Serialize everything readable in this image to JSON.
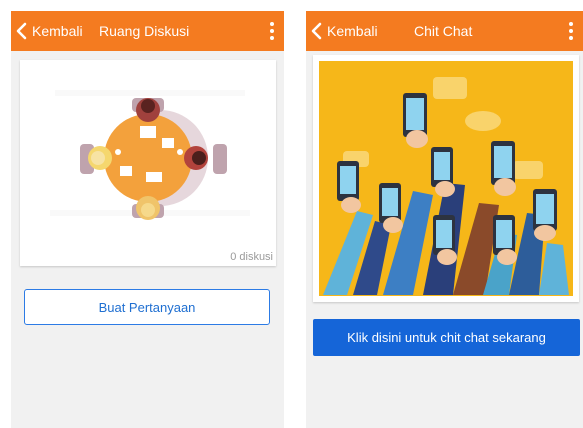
{
  "left_screen": {
    "back_label": "Kembali",
    "title": "Ruang Diskusi",
    "card": {
      "count_text": "0 diskusi"
    },
    "button_label": "Buat Pertanyaan"
  },
  "right_screen": {
    "back_label": "Kembali",
    "title": "Chit Chat",
    "button_label": "Klik disini untuk chit chat sekarang"
  },
  "icons": [
    "chevron-left-icon",
    "more-vertical-icon"
  ],
  "colors": {
    "app_bar": "#f47b20",
    "outline_button": "#2c7be5",
    "primary_button": "#1565d8",
    "background": "#f1f1f1"
  }
}
